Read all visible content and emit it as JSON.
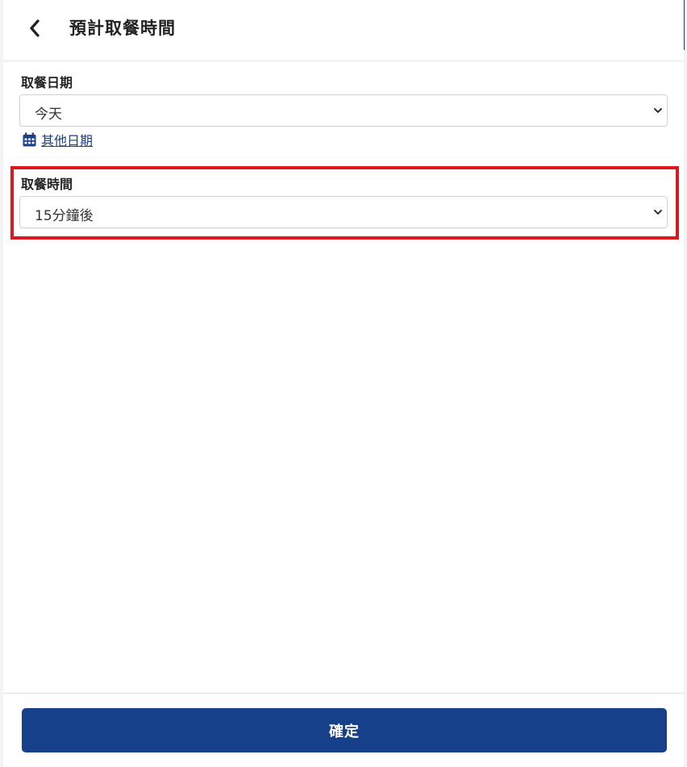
{
  "header": {
    "back_icon": "chevron-left-icon",
    "title": "預計取餐時間"
  },
  "pickup_date": {
    "label": "取餐日期",
    "selected": "今天"
  },
  "other_date": {
    "icon": "calendar-icon",
    "label": "其他日期"
  },
  "pickup_time": {
    "label": "取餐時間",
    "selected": "15分鐘後"
  },
  "footer": {
    "confirm_label": "確定"
  },
  "colors": {
    "primary": "#17408b",
    "highlight": "#e0161e",
    "link": "#1a3f8c"
  }
}
